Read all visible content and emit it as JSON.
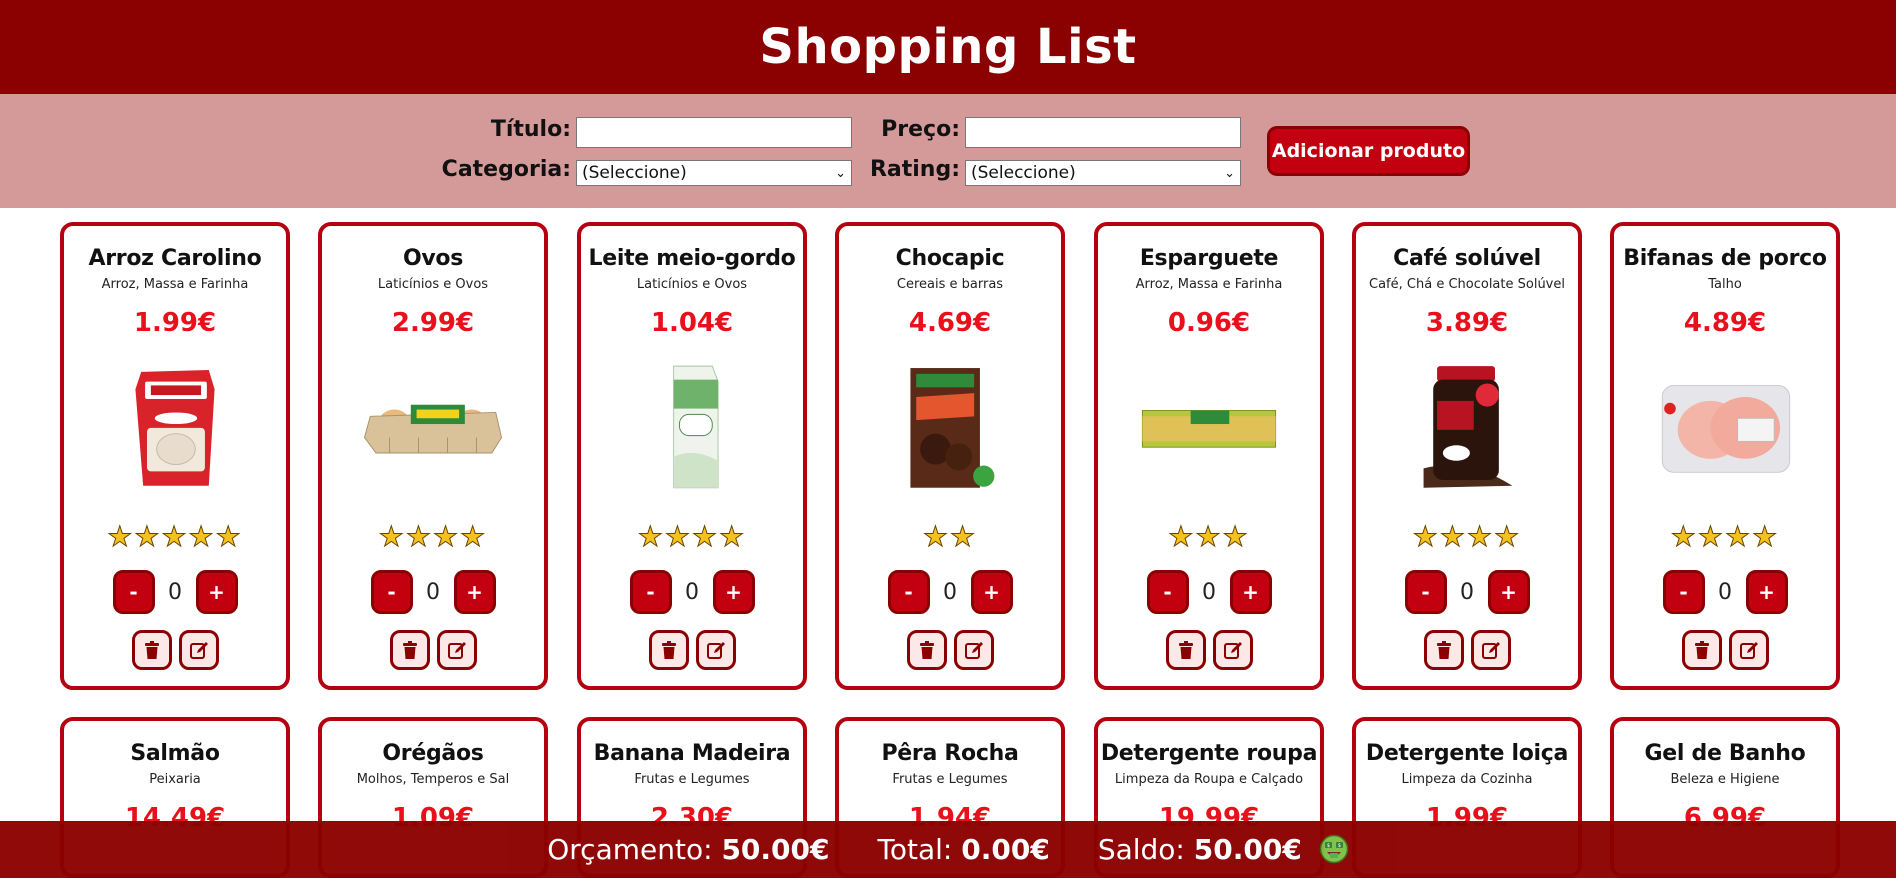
{
  "app": {
    "title": "Shopping List"
  },
  "form": {
    "titulo_label": "Título:",
    "preco_label": "Preço:",
    "categoria_label": "Categoria:",
    "rating_label": "Rating:",
    "titulo_value": "",
    "preco_value": "",
    "categoria_selected": "(Seleccione)",
    "rating_selected": "(Seleccione)",
    "add_button": "Adicionar produto"
  },
  "products": [
    {
      "title": "Arroz Carolino",
      "category": "Arroz, Massa e Farinha",
      "price": "1.99€",
      "rating": 5,
      "qty": "0",
      "image": "rice-bag-image"
    },
    {
      "title": "Ovos",
      "category": "Laticínios e Ovos",
      "price": "2.99€",
      "rating": 4,
      "qty": "0",
      "image": "egg-carton-image"
    },
    {
      "title": "Leite meio-gordo",
      "category": "Laticínios e Ovos",
      "price": "1.04€",
      "rating": 4,
      "qty": "0",
      "image": "milk-carton-image"
    },
    {
      "title": "Chocapic",
      "category": "Cereais e barras",
      "price": "4.69€",
      "rating": 2,
      "qty": "0",
      "image": "cereal-box-image"
    },
    {
      "title": "Esparguete",
      "category": "Arroz, Massa e Farinha",
      "price": "0.96€",
      "rating": 3,
      "qty": "0",
      "image": "spaghetti-pack-image"
    },
    {
      "title": "Café solúvel",
      "category": "Café, Chá e Chocolate Solúvel",
      "price": "3.89€",
      "rating": 4,
      "qty": "0",
      "image": "coffee-jar-image"
    },
    {
      "title": "Bifanas de porco",
      "category": "Talho",
      "price": "4.89€",
      "rating": 4,
      "qty": "0",
      "image": "pork-tray-image"
    },
    {
      "title": "Salmão",
      "category": "Peixaria",
      "price": "14.49€"
    },
    {
      "title": "Orégãos",
      "category": "Molhos, Temperos e Sal",
      "price": "1.09€"
    },
    {
      "title": "Banana Madeira",
      "category": "Frutas e Legumes",
      "price": "2.30€"
    },
    {
      "title": "Pêra Rocha",
      "category": "Frutas e Legumes",
      "price": "1.94€"
    },
    {
      "title": "Detergente roupa",
      "category": "Limpeza da Roupa e Calçado",
      "price": "19.99€"
    },
    {
      "title": "Detergente loiça",
      "category": "Limpeza da Cozinha",
      "price": "1.99€"
    },
    {
      "title": "Gel de Banho",
      "category": "Beleza e Higiene",
      "price": "6.99€"
    }
  ],
  "buttons": {
    "minus": "-",
    "plus": "+"
  },
  "footer": {
    "orcamento_label": "Orçamento:",
    "orcamento_value": "50.00€",
    "total_label": "Total:",
    "total_value": "0.00€",
    "saldo_label": "Saldo:",
    "saldo_value": "50.00€",
    "saldo_icon": "money-mouth-face-icon"
  },
  "colors": {
    "brand": "#8b0000",
    "accent": "#c30010",
    "price": "#e8101a",
    "form_bg": "#d49a9a",
    "star": "#f4c21e"
  }
}
